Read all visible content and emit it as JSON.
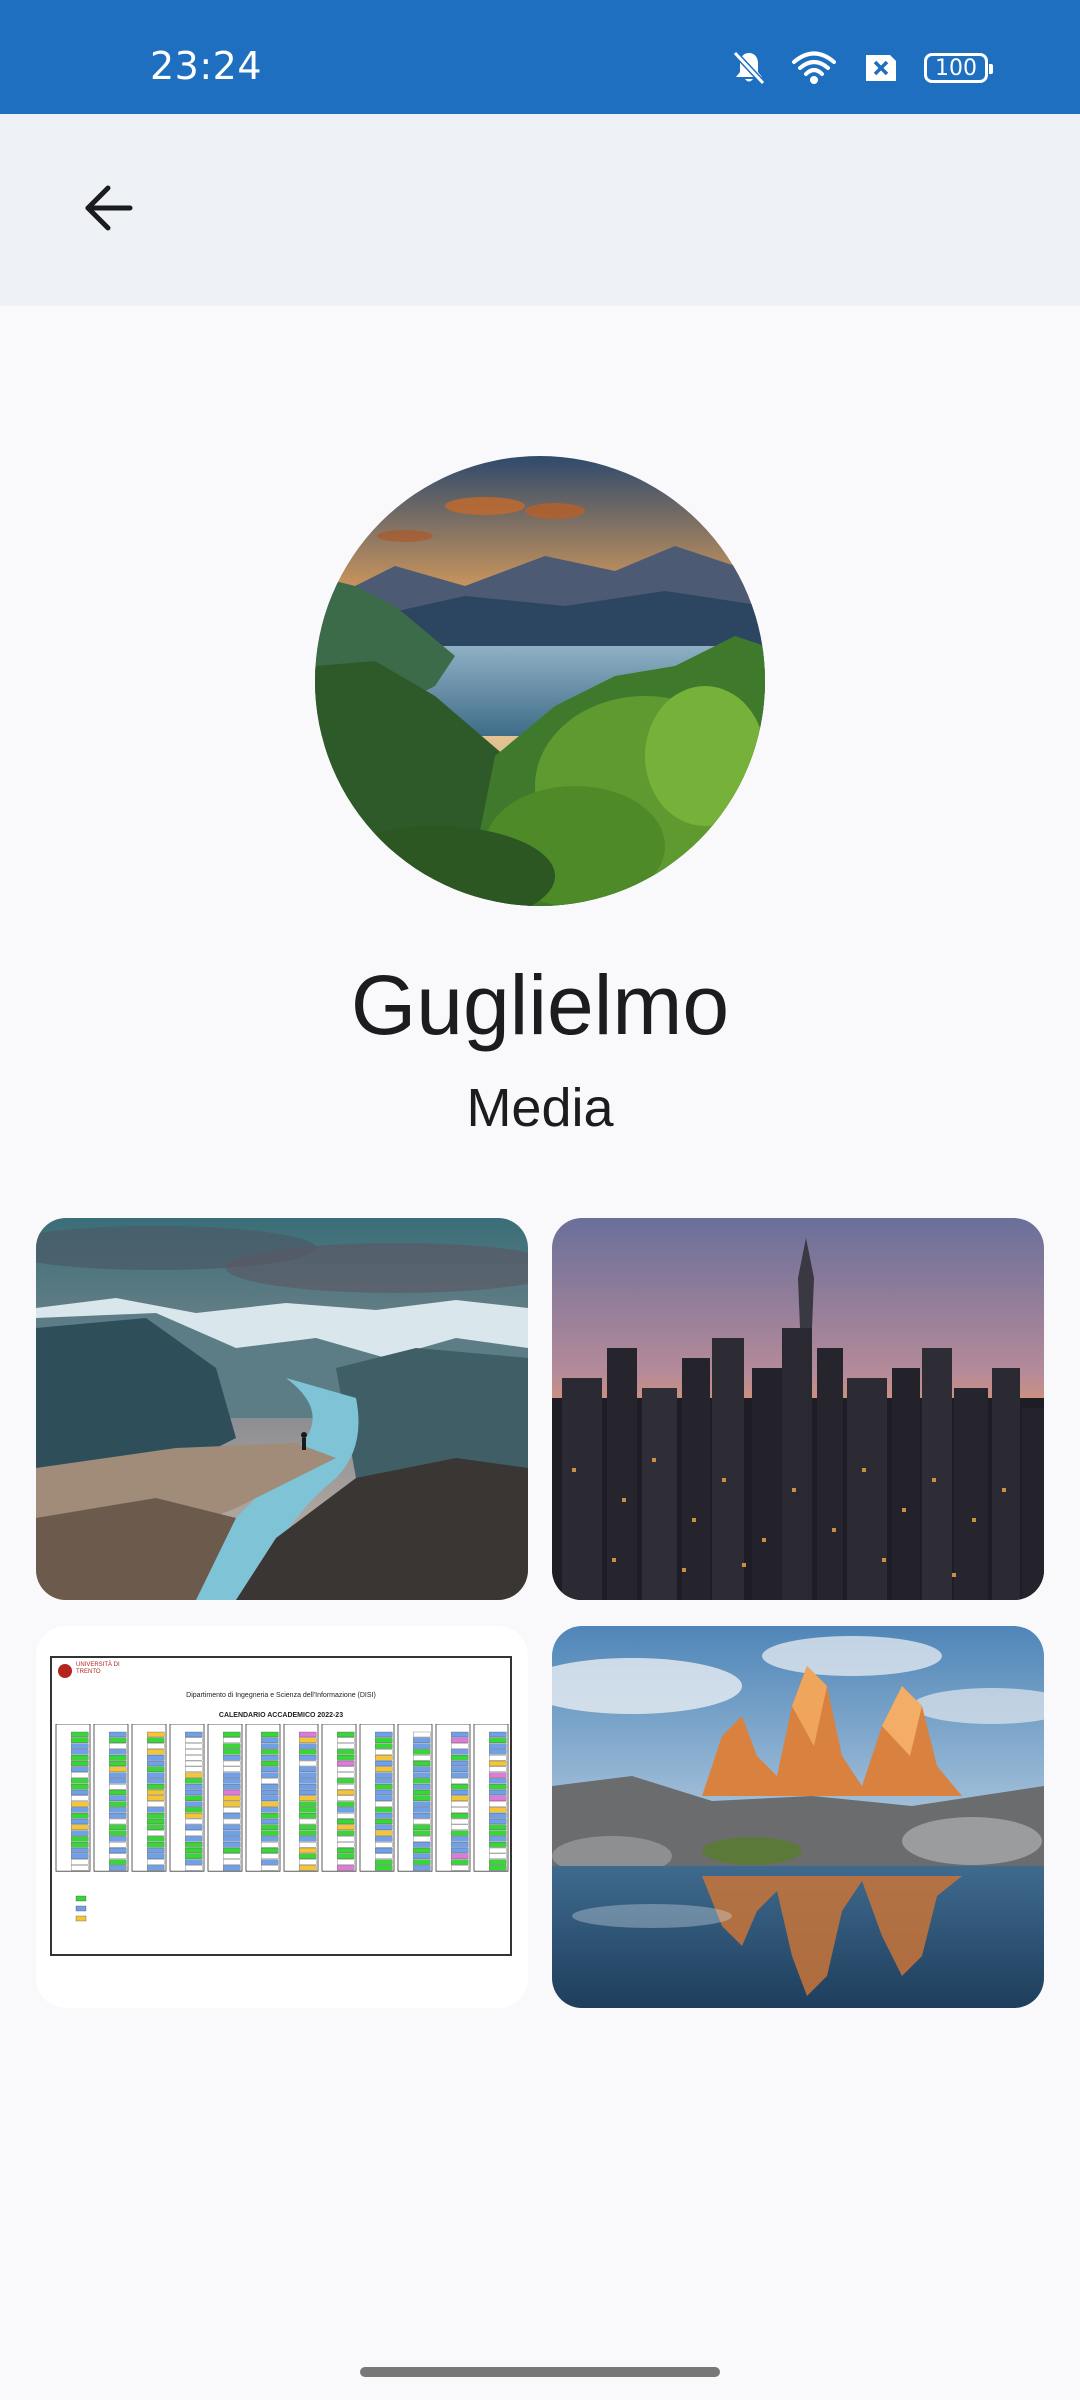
{
  "status_bar": {
    "time": "23:24",
    "icons": [
      "notifications-off-icon",
      "wifi-icon",
      "no-sim-icon",
      "battery-icon"
    ],
    "battery_level": "100",
    "background": "#1f6fc1"
  },
  "app_bar": {
    "back_icon": "arrow-back-icon",
    "background": "#eef1f6"
  },
  "profile": {
    "name": "Guglielmo",
    "avatar_image": "mountain lake sunset photo"
  },
  "media": {
    "title": "Media",
    "items": [
      {
        "image": "fjord cliff with hiker photo"
      },
      {
        "image": "city skyline at sunset photo"
      },
      {
        "image": "academic calendar document",
        "university": "UNIVERSITÀ DI TRENTO",
        "department": "Dipartimento di Ingegneria e Scienza dell'Informazione (DISI)",
        "heading": "CALENDARIO ACCADEMICO 2022-23"
      },
      {
        "image": "mountain peaks reflected in lake photo"
      }
    ]
  },
  "colors": {
    "primary": "#1f6fc1",
    "background": "#f9f9fc",
    "text": "#1c1c1f"
  }
}
